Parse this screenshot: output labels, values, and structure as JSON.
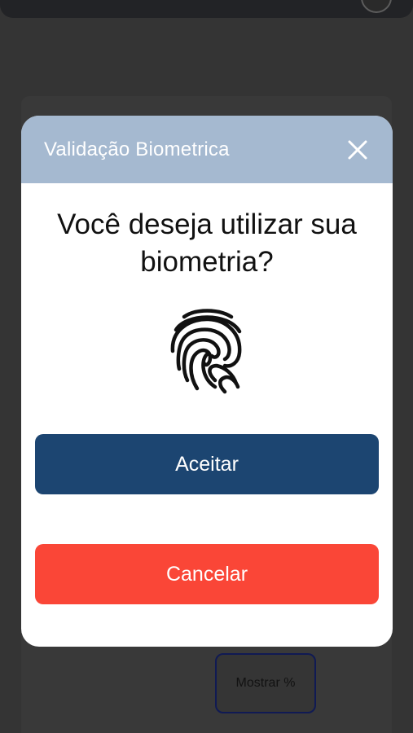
{
  "background": {
    "show_percent_label": "Mostrar %"
  },
  "dialog": {
    "title": "Validação Biometrica",
    "close_icon": "close-icon",
    "question": "Você deseja utilizar sua biometria?",
    "fingerprint_icon": "fingerprint-icon",
    "accept_label": "Aceitar",
    "cancel_label": "Cancelar"
  },
  "colors": {
    "header": "#a5b9d0",
    "accept": "#1c4571",
    "cancel": "#fa4637",
    "overlay": "#343434"
  }
}
